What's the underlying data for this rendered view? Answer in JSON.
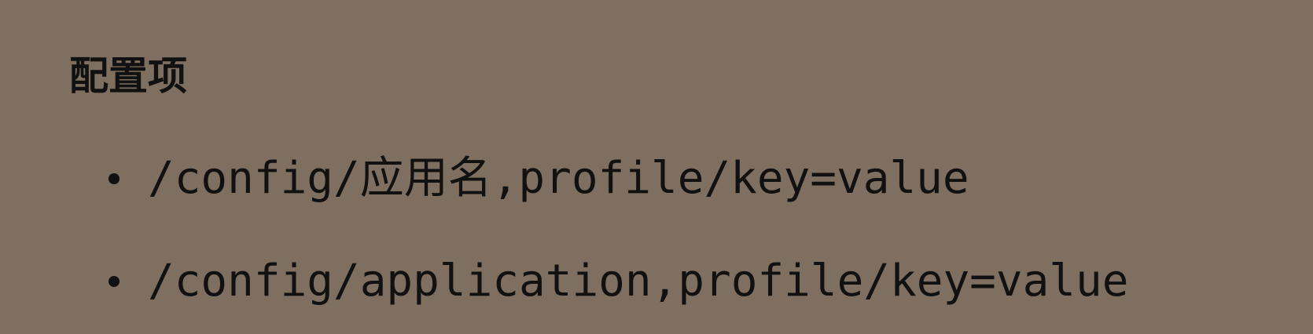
{
  "slide": {
    "title": "配置项",
    "bullets": [
      "/config/应用名,profile/key=value",
      "/config/application,profile/key=value"
    ]
  }
}
